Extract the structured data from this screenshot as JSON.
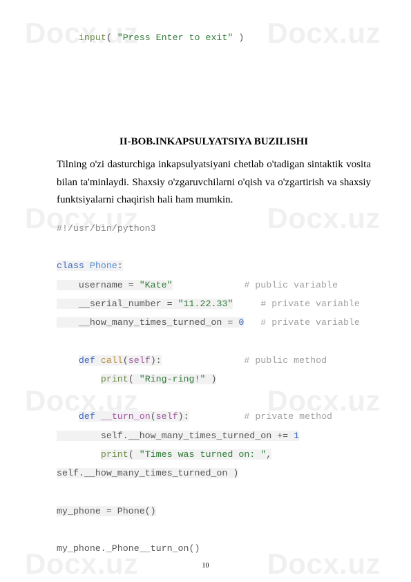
{
  "watermark": "Docx.uz",
  "top_code": {
    "indent": "    ",
    "fn": "input",
    "open": "( ",
    "str": "\"Press Enter to exit\"",
    "close": " )"
  },
  "heading": "II-BOB.INKAPSULYATSIYA BUZILISHI",
  "paragraph": "Tilning o'zi dasturchiga inkapsulyatsiyani chetlab o'tadigan sintaktik vosita bilan ta'minlaydi. Shaxsiy o'zgaruvchilarni o'qish va o'zgartirish va shaxsiy funktsiyalarni chaqirish hali ham mumkin.",
  "code": {
    "shebang": "#!/usr/bin/python3",
    "class_kw": "class",
    "class_name": "Phone",
    "colon": ":",
    "line_user_lhs": "    username = ",
    "line_user_str": "\"Kate\"",
    "line_user_pad": "             ",
    "line_user_cmt": "# public variable",
    "line_serial_lhs": "    __serial_number = ",
    "line_serial_str": "\"11.22.33\"",
    "line_serial_pad": "     ",
    "line_serial_cmt": "# private variable",
    "line_how_lhs": "    __how_many_times_turned_on = ",
    "line_how_num": "0",
    "line_how_pad": "   ",
    "line_how_cmt": "# private variable",
    "def_kw": "def",
    "call_name": "call",
    "self_kw": "self",
    "call_pad": "               ",
    "call_cmt": "# public method",
    "print_kw": "print",
    "ring_str": "\"Ring-ring!\"",
    "turn_name": "__turn_on",
    "turn_pad": "          ",
    "turn_cmt": "# private method",
    "inc_line_a": "        self.__how_many_times_turned_on += ",
    "inc_num": "1",
    "times_str": "\"Times was turned on: \"",
    "comma": ",",
    "print_cont": "self.__how_many_times_turned_on )",
    "myphone_line": "my_phone = Phone()",
    "last_line": "my_phone._Phone__turn_on()"
  },
  "page_number": "10"
}
